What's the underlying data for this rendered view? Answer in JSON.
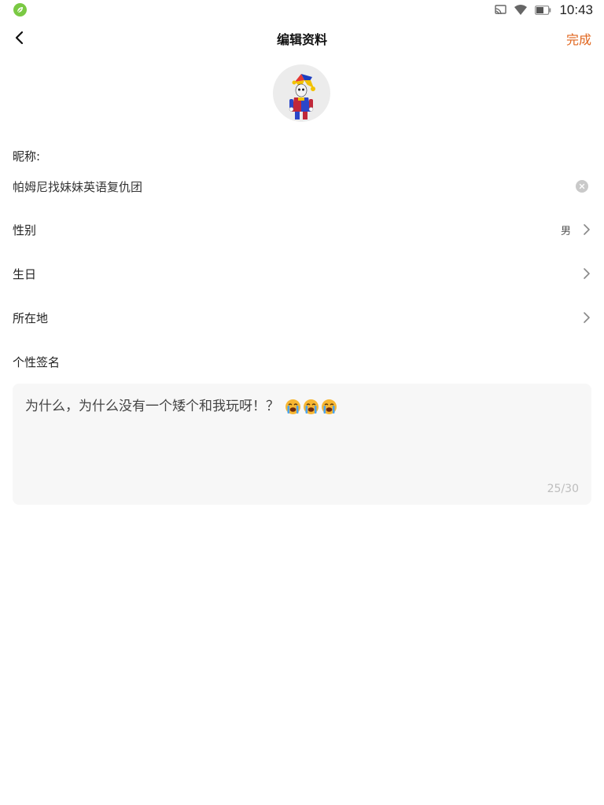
{
  "status_bar": {
    "time": "10:43",
    "icons": [
      "cast-icon",
      "wifi-icon",
      "battery-icon"
    ]
  },
  "header": {
    "title": "编辑资料",
    "done_label": "完成",
    "back_icon": "chevron-left-icon"
  },
  "profile": {
    "nickname_label": "昵称:",
    "nickname_value": "帕姆尼找妹妹英语复仇团",
    "gender_label": "性别",
    "gender_value": "男",
    "birthday_label": "生日",
    "location_label": "所在地",
    "signature_label": "个性签名",
    "signature_text": "为什么，为什么没有一个矮个和我玩呀！？",
    "signature_emoji": "loudly-crying-face",
    "signature_counter": "25/30"
  },
  "colors": {
    "accent": "#e0651d",
    "app_icon": "#7ac943",
    "field_bg": "#f7f7f7"
  }
}
